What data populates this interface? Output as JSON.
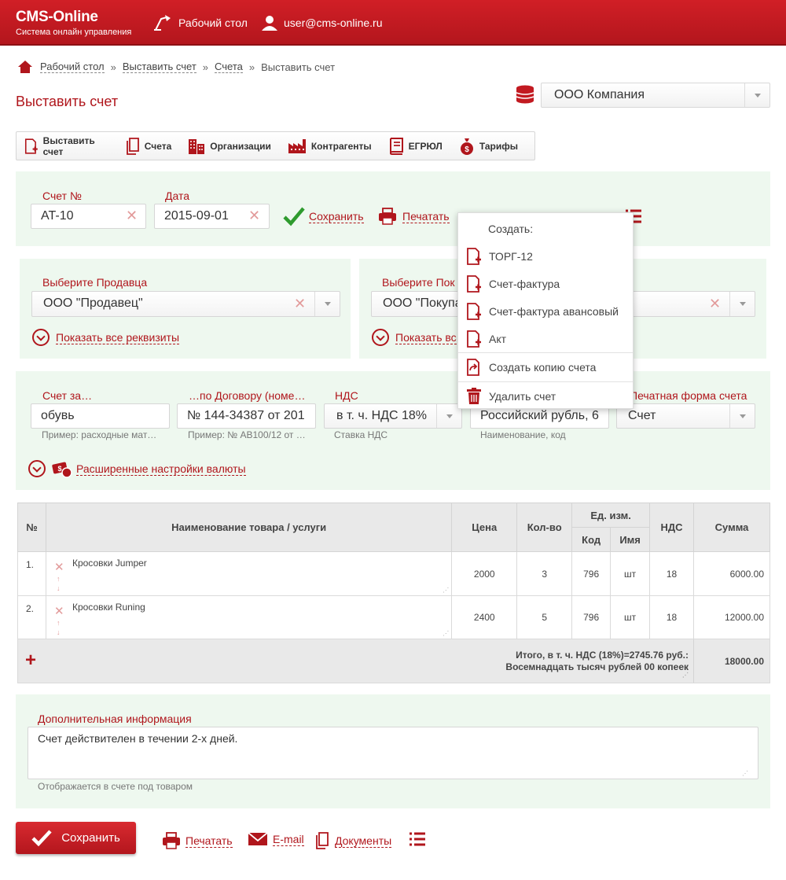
{
  "header": {
    "brand_title": "CMS-Online",
    "brand_subtitle": "Система онлайн управления",
    "dashboard_label": "Рабочий стол",
    "user_email": "user@cms-online.ru"
  },
  "breadcrumb": {
    "items": [
      "Рабочий стол",
      "Выставить счет",
      "Счета"
    ],
    "current": "Выставить счет"
  },
  "page_title": "Выставить счет",
  "company_select": {
    "value": "ООО Компания"
  },
  "toolbar": {
    "items": [
      "Выставить счет",
      "Счета",
      "Организации",
      "Контрагенты",
      "ЕГРЮЛ",
      "Тарифы"
    ]
  },
  "invoice": {
    "number_label": "Счет №",
    "number_value": "AT-10",
    "date_label": "Дата",
    "date_value": "2015-09-01",
    "save_label": "Сохранить",
    "print_label": "Печатать"
  },
  "dropdown_menu": {
    "header": "Создать:",
    "items": [
      "ТОРГ-12",
      "Счет-фактура",
      "Счет-фактура авансовый",
      "Акт"
    ],
    "copy_label": "Создать копию счета",
    "delete_label": "Удалить счет"
  },
  "seller": {
    "label": "Выберите Продавца",
    "value": "ООО \"Продавец\"",
    "show_details": "Показать все реквизиты"
  },
  "buyer": {
    "label": "Выберите Пок",
    "value": "ООО \"Покупа",
    "show_details": "Показать вс"
  },
  "details": {
    "for_label": "Счет за…",
    "for_value": "обувь",
    "for_hint": "Пример: расходные мат…",
    "contract_label": "…по Договору (номе…",
    "contract_value": "№ 144-34387 от 201",
    "contract_hint": "Пример: № AB100/12 от …",
    "vat_label": "НДС",
    "vat_value": "в т. ч. НДС 18%",
    "vat_hint": "Ставка НДС",
    "currency_value": "Российский рубль, 6",
    "currency_hint": "Наименование, код",
    "print_form_label": "Печатная форма счета",
    "print_form_value": "Счет",
    "currency_settings": "Расширенные настройки валюты"
  },
  "table": {
    "headers": {
      "num": "№",
      "name": "Наименование товара / услуги",
      "price": "Цена",
      "qty": "Кол-во",
      "unit": "Ед. изм.",
      "unit_code": "Код",
      "unit_name": "Имя",
      "vat": "НДС",
      "sum": "Сумма"
    },
    "rows": [
      {
        "num": "1.",
        "name": "Кросовки Jumper",
        "price": "2000",
        "qty": "3",
        "code": "796",
        "unit": "шт",
        "vat": "18",
        "sum": "6000.00"
      },
      {
        "num": "2.",
        "name": "Кросовки Runing",
        "price": "2400",
        "qty": "5",
        "code": "796",
        "unit": "шт",
        "vat": "18",
        "sum": "12000.00"
      }
    ],
    "total_line1": "Итого, в т. ч. НДС (18%)=2745.76 руб.:",
    "total_line2": "Восемнадцать тысяч рублей 00 копеек",
    "total_sum": "18000.00"
  },
  "additional": {
    "label": "Дополнительная информация",
    "value": "Счет действителен в течении 2-х дней.",
    "hint": "Отображается в счете под товаром"
  },
  "footer": {
    "save_label": "Сохранить",
    "print_label": "Печатать",
    "email_label": "E-mail",
    "docs_label": "Документы"
  },
  "colors": {
    "brand_red": "#c21a21",
    "panel_green": "#eef8ef",
    "accent_green": "#2e9b2e"
  }
}
